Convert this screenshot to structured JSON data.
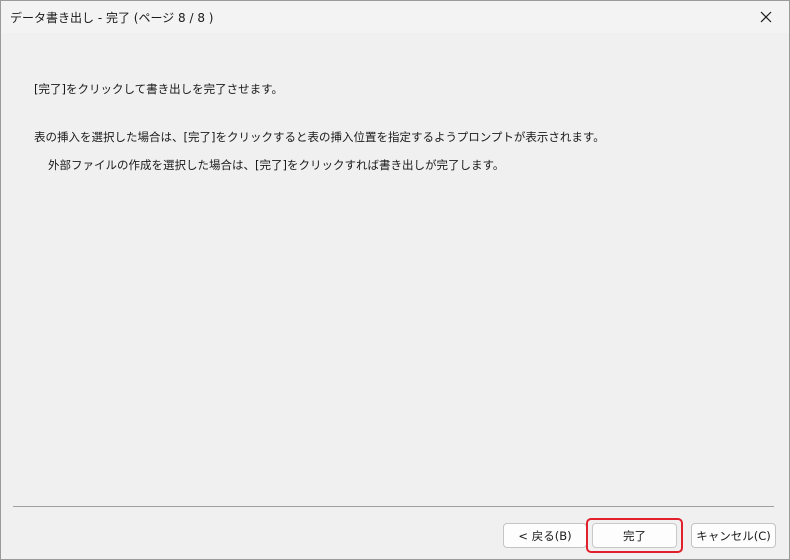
{
  "window": {
    "title": "データ書き出し - 完了 (ページ 8 / 8 )",
    "close_icon": "close-icon"
  },
  "content": {
    "line1": "[完了]をクリックして書き出しを完了させます。",
    "line2": "表の挿入を選択した場合は、[完了]をクリックすると表の挿入位置を指定するようプロンプトが表示されます。",
    "line3": "外部ファイルの作成を選択した場合は、[完了]をクリックすれば書き出しが完了します。"
  },
  "buttons": {
    "back": "< 戻る(B)",
    "finish": "完了",
    "cancel": "キャンセル(C)"
  },
  "colors": {
    "highlight": "#e0202a",
    "background": "#f0f0f0"
  }
}
